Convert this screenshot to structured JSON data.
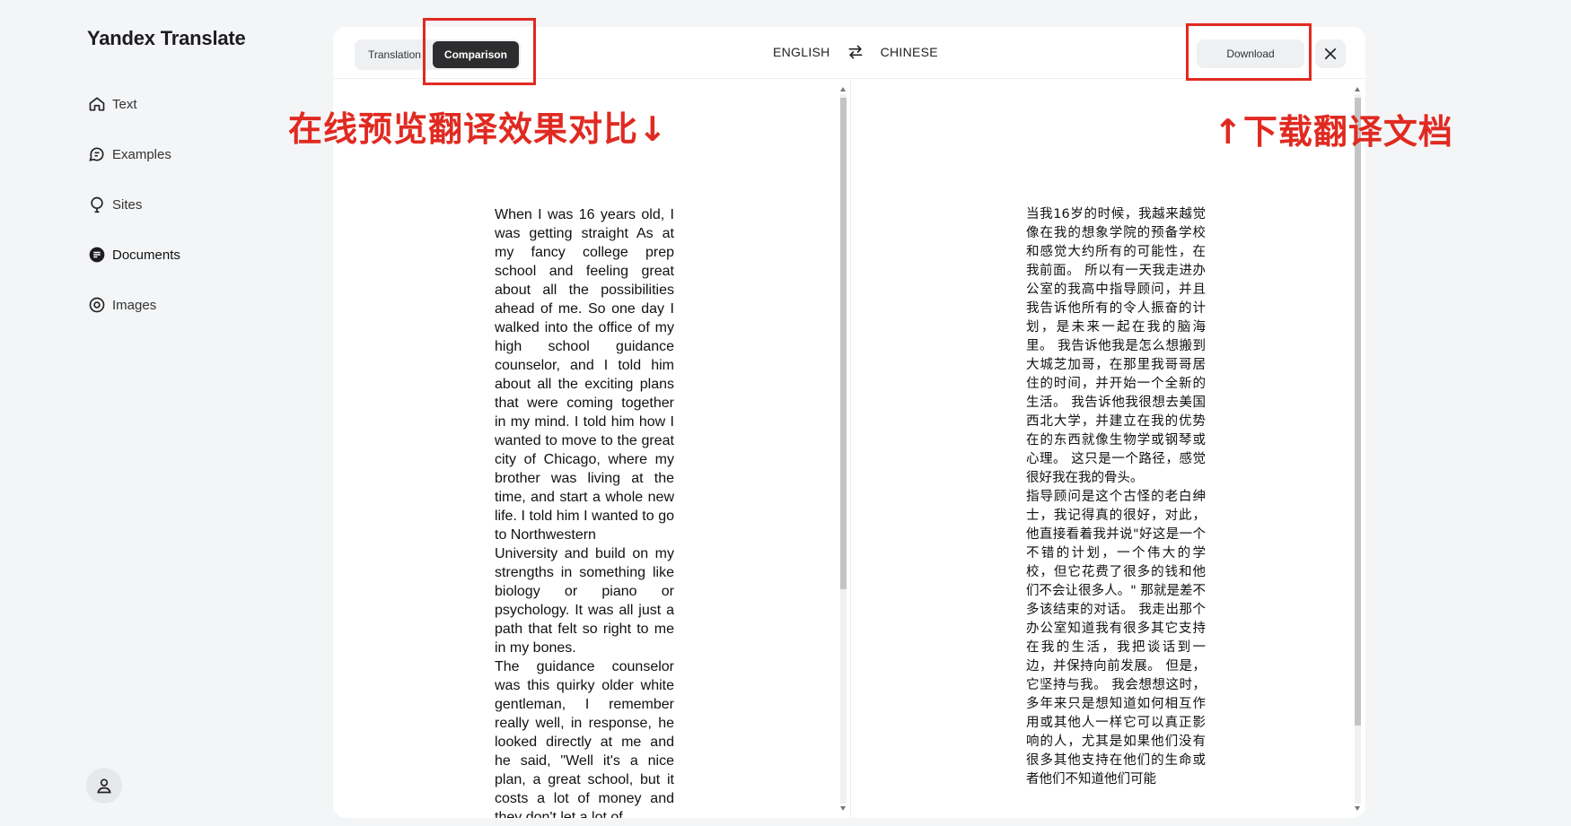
{
  "app": {
    "title": "Yandex Translate"
  },
  "sidebar": {
    "items": [
      {
        "label": "Text",
        "icon": "home-icon"
      },
      {
        "label": "Examples",
        "icon": "chat-bubbles-icon"
      },
      {
        "label": "Sites",
        "icon": "globe-pin-icon"
      },
      {
        "label": "Documents",
        "icon": "document-icon",
        "active": true
      },
      {
        "label": "Images",
        "icon": "camera-icon"
      }
    ]
  },
  "toolbar": {
    "mode_translation": "Translation",
    "mode_comparison": "Comparison",
    "source_lang": "ENGLISH",
    "target_lang": "CHINESE",
    "download_label": "Download"
  },
  "document": {
    "source_paragraphs": [
      "When I was 16 years old, I was getting straight As at my fancy college prep school and feeling great about all the possibilities ahead of me. So one day I walked into the office of my high school guidance counselor, and I told him about all the exciting plans that were coming together in my mind. I told him how I wanted to move to the great city of Chicago, where my brother was living at the time, and start a whole new life. I told him I wanted to go to Northwestern",
      "University and build on my strengths in something like biology or piano or psychology. It was all just a path that felt so right to me in my bones.",
      "The guidance counselor was this quirky older white gentleman, I remember really well, in response, he looked directly at me and he said, \"Well it's a nice plan, a great school, but it costs a lot of money and they don't let a lot of"
    ],
    "translated_paragraphs": [
      "当我16岁的时候，我越来越觉像在我的想象学院的预备学校和感觉大约所有的可能性，在我前面。 所以有一天我走进办公室的我高中指导顾问，并且我告诉他所有的令人振奋的计划，是未来一起在我的脑海里。 我告诉他我是怎么想搬到大城芝加哥，在那里我哥哥居住的时间，并开始一个全新的生活。 我告诉他我很想去美国西北大学，并建立在我的优势在的东西就像生物学或钢琴或心理。 这只是一个路径，感觉很好我在我的骨头。",
      "指导顾问是这个古怪的老白绅士，我记得真的很好，对此，他直接看着我并说\"好这是一个不错的计划，一个伟大的学校，但它花费了很多的钱和他们不会让很多人。\" 那就是差不多该结束的对话。 我走出那个办公室知道我有很多其它支持在我的生活，我把谈话到一边，并保持向前发展。 但是，它坚持与我。 我会想想这时，多年来只是想知道如何相互作用或其他人一样它可以真正影响的人，尤其是如果他们没有很多其他支持在他们的生命或者他们不知道他们可能"
    ]
  },
  "annotations": {
    "left_caption": "在线预览翻译效果对比↓",
    "right_caption": "↑下载翻译文档",
    "color": "#e02a21"
  }
}
